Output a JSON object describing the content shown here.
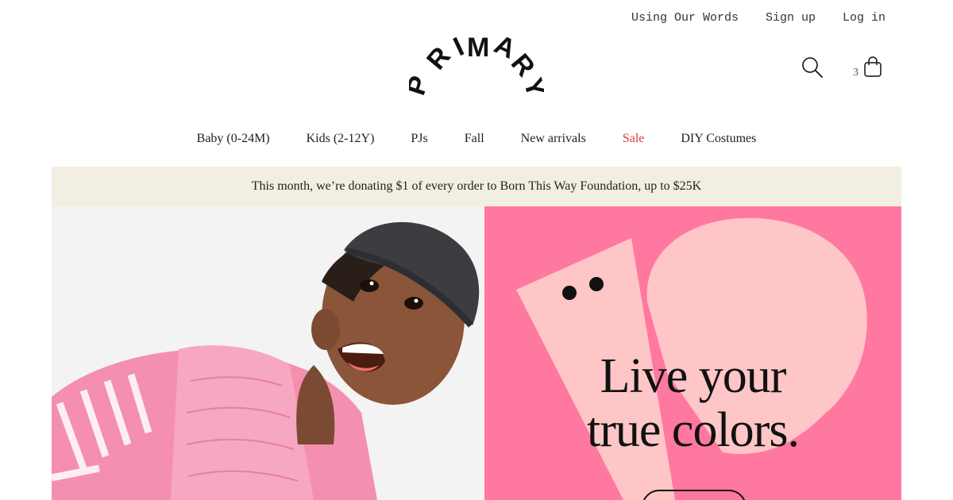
{
  "topbar": {
    "links": [
      "Using Our Words",
      "Sign up",
      "Log in"
    ]
  },
  "logo": {
    "text": "PRIMARY"
  },
  "header": {
    "search_icon": "search-icon",
    "cart_icon": "shopping-bag-icon",
    "cart_count": "3"
  },
  "nav": {
    "items": [
      "Baby (0-24M)",
      "Kids (2-12Y)",
      "PJs",
      "Fall",
      "New arrivals",
      "Sale",
      "DIY Costumes"
    ],
    "sale_color": "#e03a3a"
  },
  "announcement": {
    "text": "This month, we’re donating $1 of every order to Born This Way Foundation, up to $25K",
    "background": "#f3eee2"
  },
  "hero": {
    "promo_background": "#ff78a0",
    "promo_line1": "Live your",
    "promo_line2": "true colors."
  }
}
